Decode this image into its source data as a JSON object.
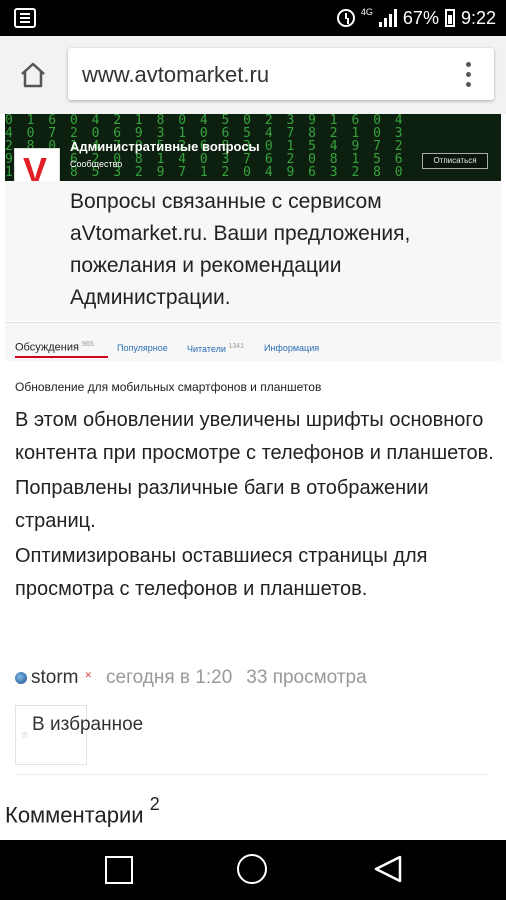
{
  "status_bar": {
    "network": "4G",
    "battery": "67%",
    "time": "9:22"
  },
  "browser": {
    "url": "www.avtomarket.ru"
  },
  "community": {
    "logo_letter": "V",
    "title": "Административные вопросы",
    "subtitle": "Сообщество",
    "unsubscribe_label": "Отписаться",
    "description": "Вопросы связанные с сервисом aVtomarket.ru. Ваши предложения, пожелания и рекомендации Администрации."
  },
  "tabs": [
    {
      "label": "Обсуждения",
      "count": "965"
    },
    {
      "label": "Популярное"
    },
    {
      "label": "Читатели",
      "count": "1341"
    },
    {
      "label": "Информация"
    }
  ],
  "article": {
    "title": "Обновление для мобильных смартфонов и планшетов",
    "paragraphs": [
      "В этом обновлении увеличены шрифты основного контента при просмотре с телефонов и планшетов.",
      "Поправлены различные баги в отображении страниц.",
      "Оптимизированы оставшиеся страницы для просмотра с телефонов и планшетов."
    ],
    "author": "storm",
    "date": "сегодня в 1:20",
    "views": "33 просмотра",
    "favorite_label": "В избранное"
  },
  "comments": {
    "label": "Комментарии",
    "count": "2"
  },
  "colors": {
    "accent_red": "#d0021b",
    "link_blue": "#2a6fb5",
    "matrix_green": "#3dbb45"
  }
}
